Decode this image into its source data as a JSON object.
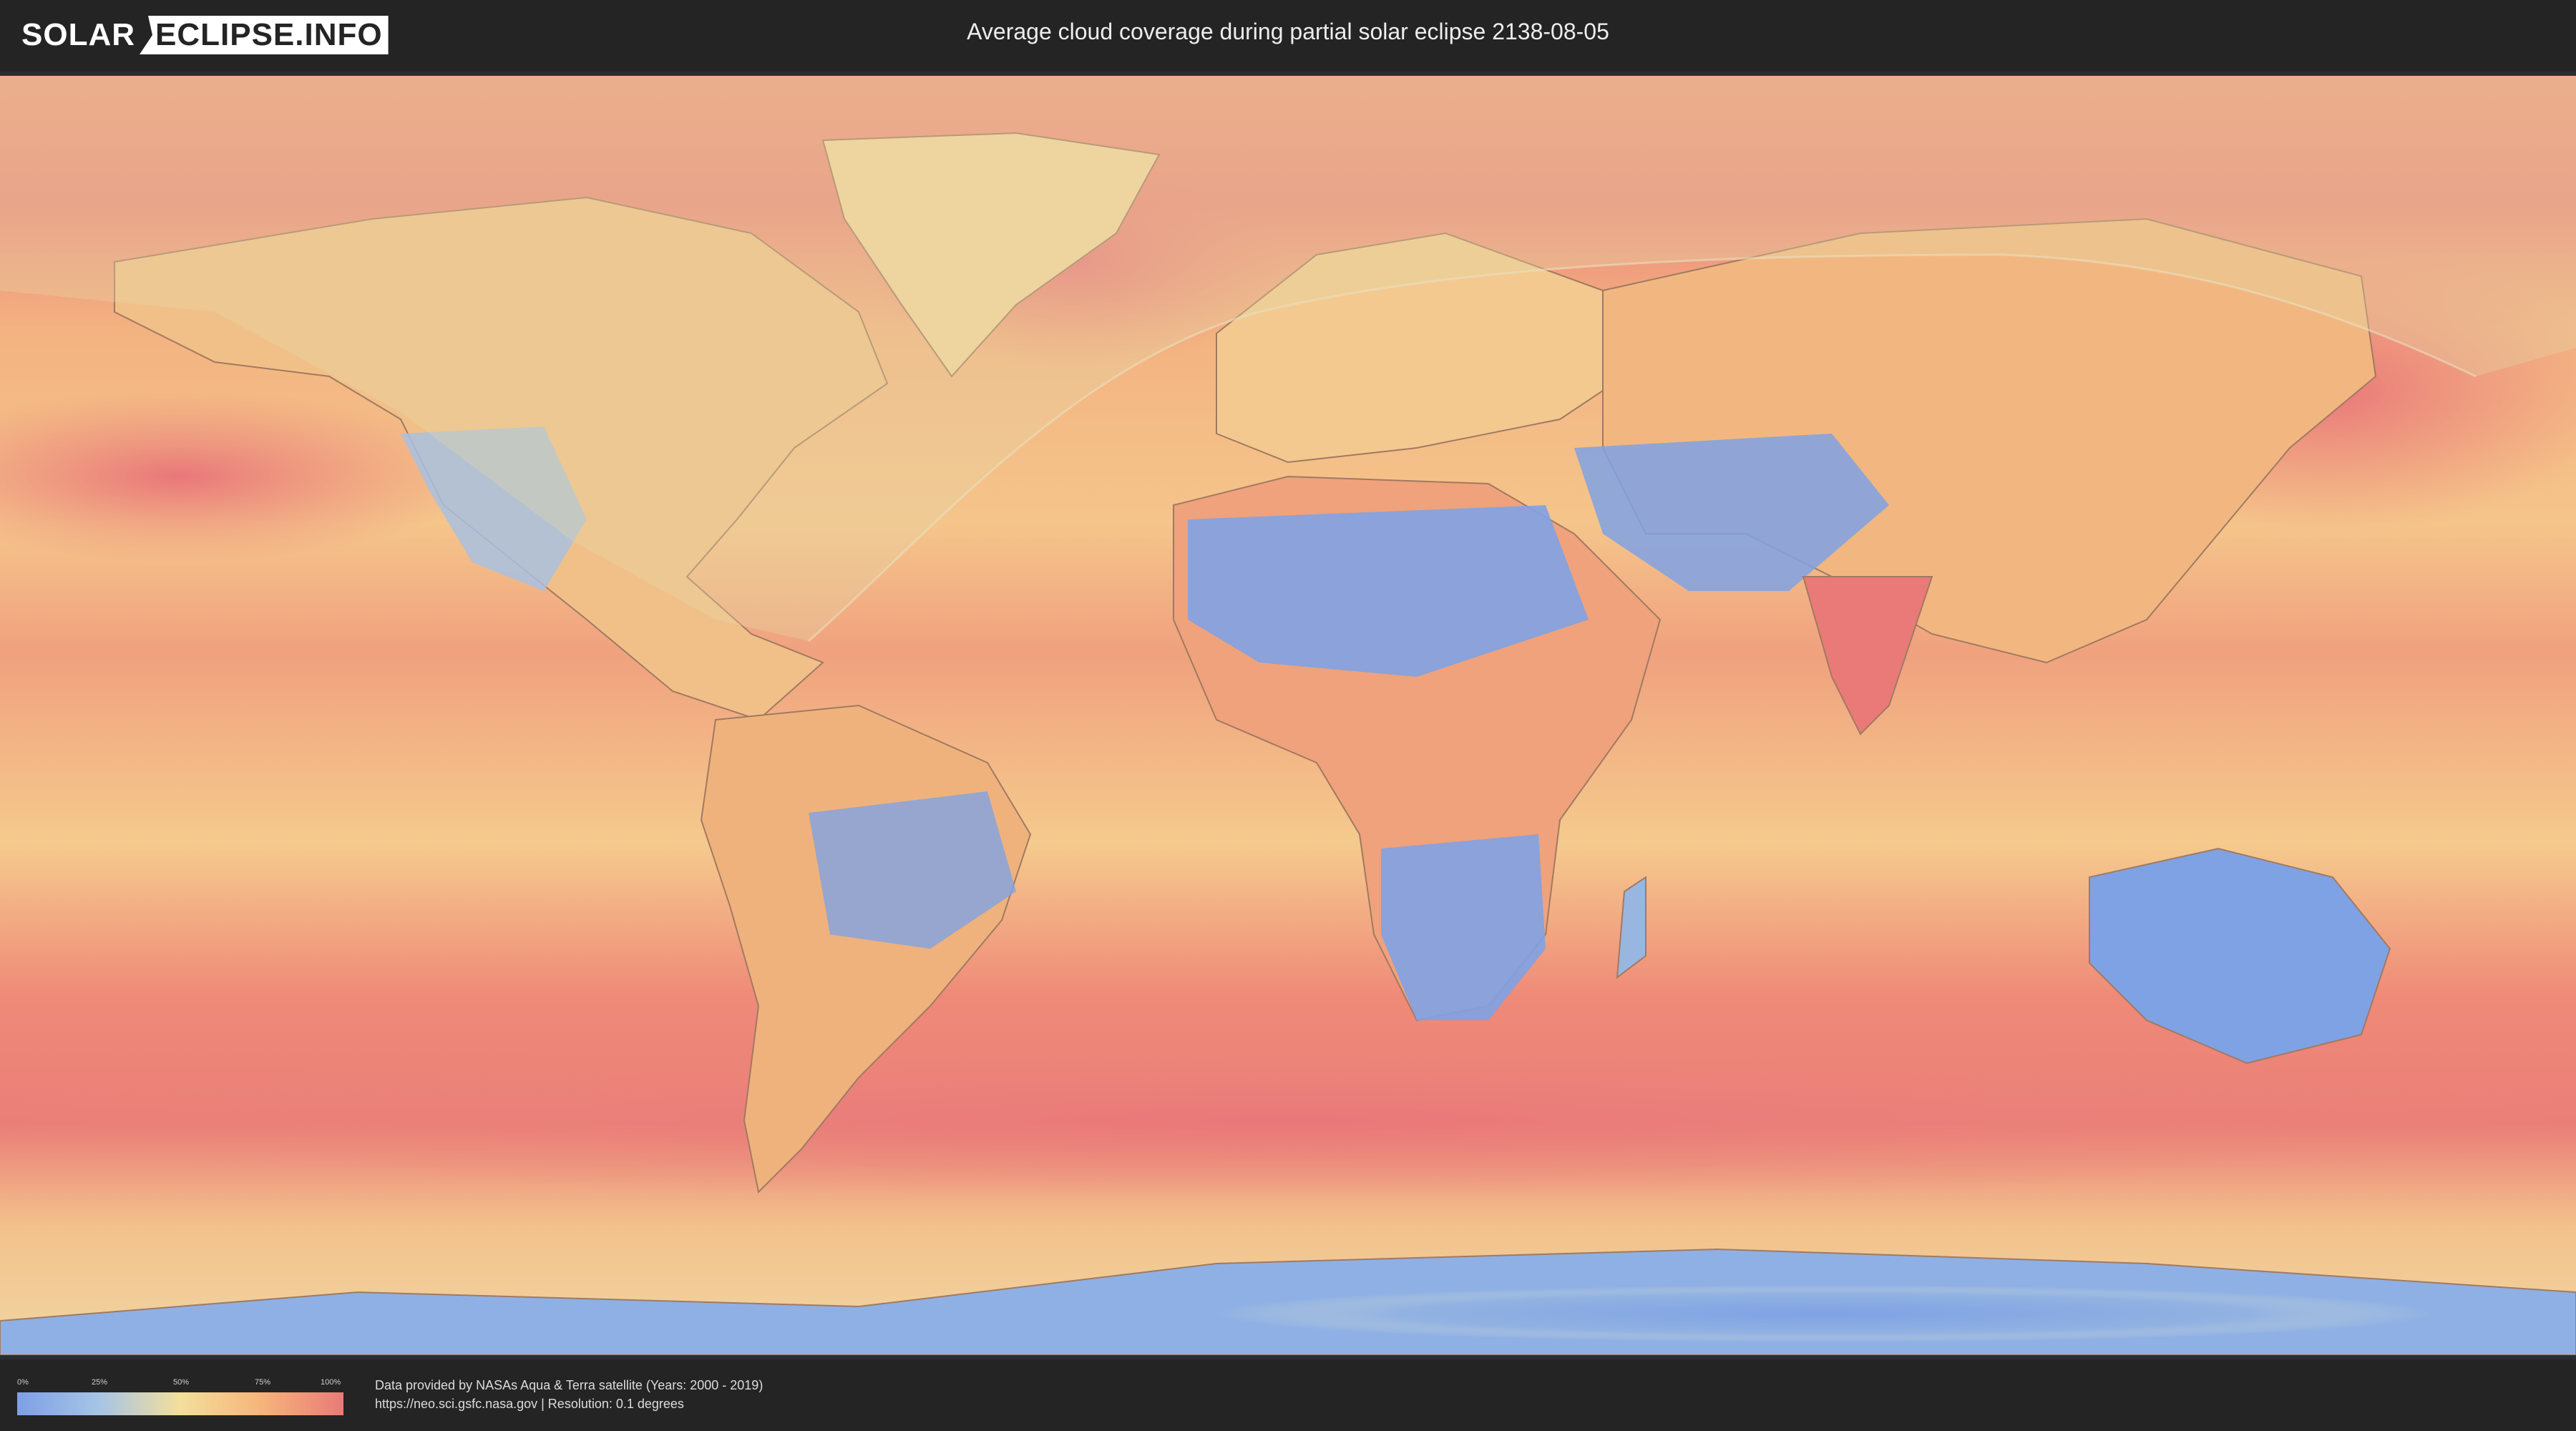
{
  "header": {
    "logo_left": "SOLAR",
    "logo_right": "ECLIPSE.INFO",
    "title": "Average cloud coverage during partial solar eclipse 2138-08-05"
  },
  "legend": {
    "ticks": [
      "0%",
      "25%",
      "50%",
      "75%",
      "100%"
    ],
    "colors": [
      "#7da0e6",
      "#a6c4e6",
      "#f4df9b",
      "#f6b47a",
      "#ea7a78"
    ]
  },
  "credits": {
    "line1": "Data provided by NASAs Aqua & Terra satellite (Years: 2000 - 2019)",
    "line2": "https://neo.sci.gsfc.nasa.gov | Resolution: 0.1 degrees"
  },
  "map": {
    "projection": "equirectangular",
    "base_ocean_color": "#f2b27f",
    "eclipse_zone_color": "#e6d7a6"
  }
}
